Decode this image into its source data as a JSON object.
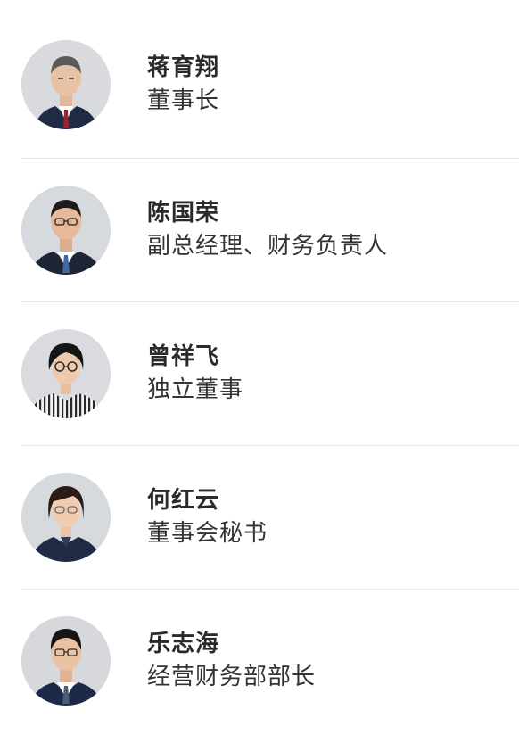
{
  "people": [
    {
      "name": "蒋育翔",
      "role": "董事长"
    },
    {
      "name": "陈国荣",
      "role": "副总经理、财务负责人"
    },
    {
      "name": "曾祥飞",
      "role": "独立董事"
    },
    {
      "name": "何红云",
      "role": "董事会秘书"
    },
    {
      "name": "乐志海",
      "role": "经营财务部部长"
    }
  ],
  "colors": {
    "divider": "#e6e6e6",
    "avatar_bg": "#d7d9dc",
    "text": "#2b2b2b"
  }
}
